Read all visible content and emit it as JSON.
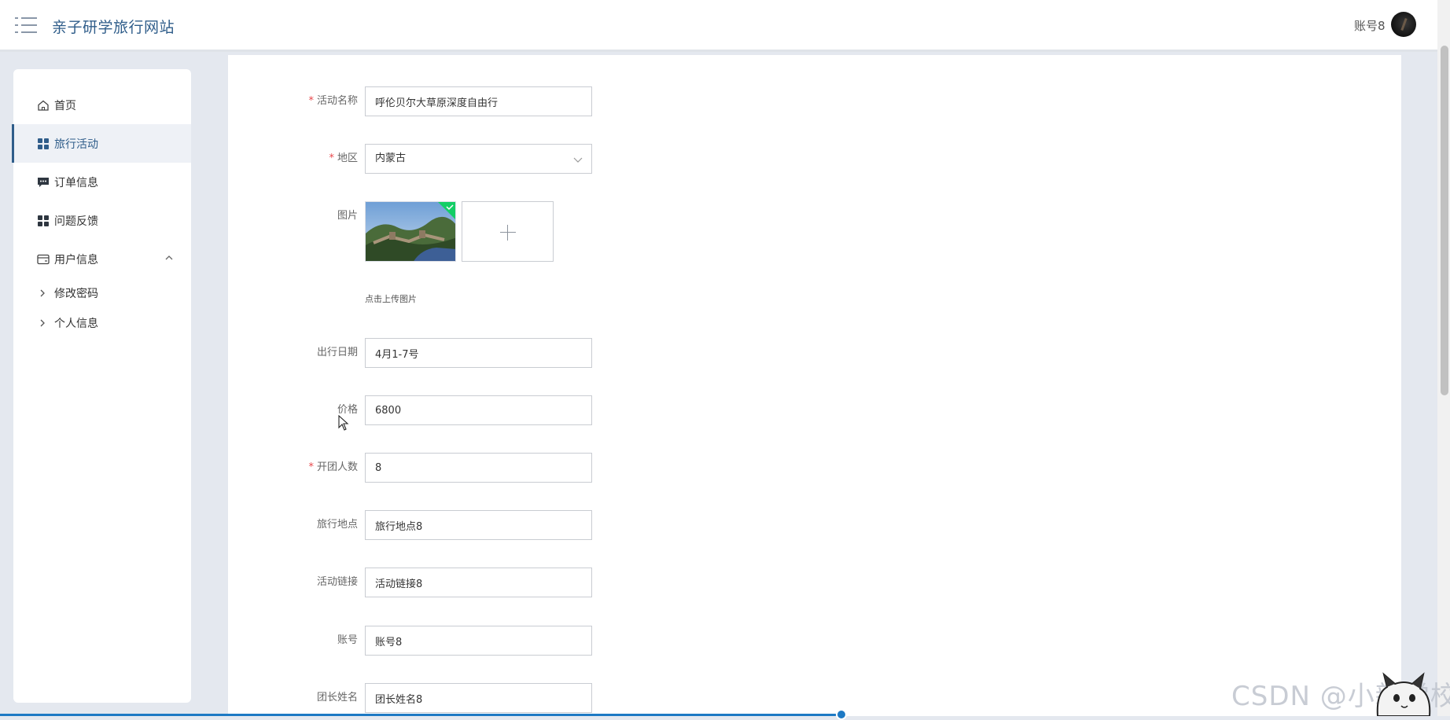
{
  "header": {
    "site_title": "亲子研学旅行网站",
    "account_name": "账号8"
  },
  "sidebar": {
    "items": [
      {
        "label": "首页",
        "icon": "home-icon"
      },
      {
        "label": "旅行活动",
        "icon": "grid-icon",
        "active": true
      },
      {
        "label": "订单信息",
        "icon": "message-icon"
      },
      {
        "label": "问题反馈",
        "icon": "grid-icon"
      },
      {
        "label": "用户信息",
        "icon": "wallet-icon",
        "expanded": true
      }
    ],
    "sub_items": [
      {
        "label": "修改密码"
      },
      {
        "label": "个人信息"
      }
    ]
  },
  "form": {
    "activity_name": {
      "label": "活动名称",
      "required": true,
      "value": "呼伦贝尔大草原深度自由行"
    },
    "region": {
      "label": "地区",
      "required": true,
      "value": "内蒙古"
    },
    "image": {
      "label": "图片",
      "upload_tip": "点击上传图片"
    },
    "travel_date": {
      "label": "出行日期",
      "required": false,
      "value": "4月1-7号"
    },
    "price": {
      "label": "价格",
      "required": false,
      "value": "6800"
    },
    "group_size": {
      "label": "开团人数",
      "required": true,
      "value": "8"
    },
    "travel_location": {
      "label": "旅行地点",
      "required": false,
      "value": "旅行地点8"
    },
    "activity_link": {
      "label": "活动链接",
      "required": false,
      "value": "活动链接8"
    },
    "account": {
      "label": "账号",
      "required": false,
      "value": "账号8"
    },
    "leader_name": {
      "label": "团长姓名",
      "required": false,
      "value": "团长姓名8"
    }
  },
  "watermark": "CSDN @小新学校",
  "colors": {
    "accent": "#2f5d8a",
    "required": "#e8474b",
    "progress": "#1d79c4"
  }
}
